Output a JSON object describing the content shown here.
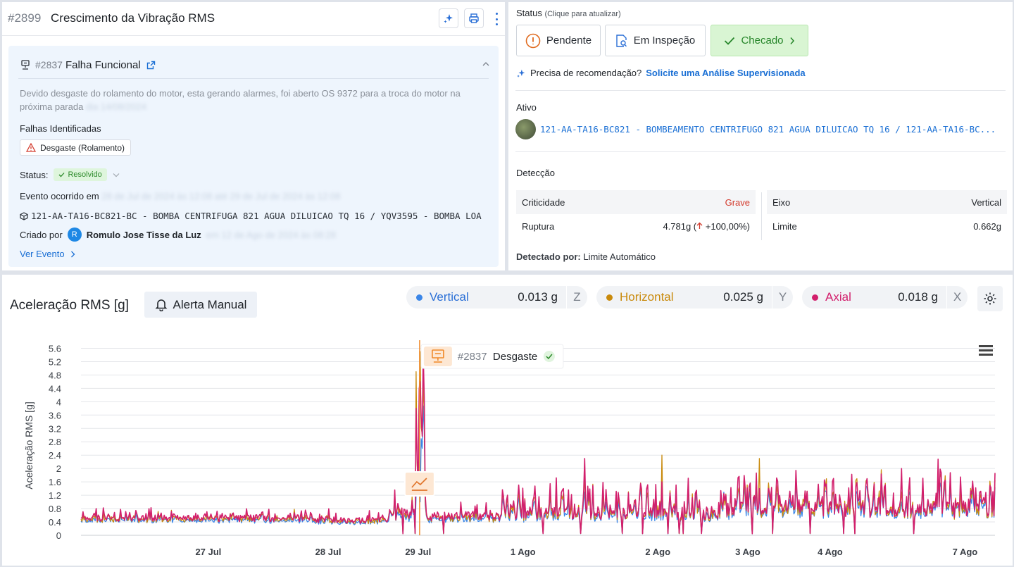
{
  "header": {
    "id": "#2899",
    "title": "Crescimento da Vibração RMS"
  },
  "event": {
    "id": "#2837",
    "title": "Falha Funcional",
    "description": "Devido desgaste do rolamento do motor, esta gerando alarmes, foi aberto OS 9372 para a troca do motor na próxima parada",
    "description_blurred": "dia 14/08/2024",
    "faults_label": "Falhas Identificadas",
    "fault_chip": "Desgaste (Rolamento)",
    "status_label": "Status:",
    "status_value": "Resolvido",
    "occurred_label": "Evento ocorrido em",
    "occurred_blurred": "28 de Jul de 2024 às 12:08 até 29 de Jul de 2024 às 12:08",
    "asset": "121-AA-TA16-BC821-BC - BOMBA CENTRIFUGA 821 AGUA DILUICAO TQ 16 / YQV3595 - BOMBA LOA",
    "created_label": "Criado por",
    "creator_initial": "R",
    "creator": "Romulo Jose Tisse da Luz",
    "created_blurred": "em 12 de Ago de 2024 às 08:28",
    "view_link": "Ver Evento"
  },
  "status_panel": {
    "title": "Status",
    "hint": "(Clique para atualizar)",
    "buttons": [
      "Pendente",
      "Em Inspeção",
      "Checado"
    ],
    "reco_text": "Precisa de recomendação?",
    "reco_link": "Solicite uma Análise Supervisionada",
    "asset_heading": "Ativo",
    "asset_link": "121-AA-TA16-BC821 - BOMBEAMENTO CENTRIFUGO 821 AGUA DILUICAO TQ 16 / 121-AA-TA16-BC...",
    "detection_heading": "Detecção",
    "det": {
      "criticidade_label": "Criticidade",
      "criticidade_value": "Grave",
      "ruptura_label": "Ruptura",
      "ruptura_value": "4.781g (",
      "ruptura_pct": " +100,00%)",
      "eixo_label": "Eixo",
      "eixo_value": "Vertical",
      "limite_label": "Limite",
      "limite_value": "0.662g"
    },
    "detected_by_label": "Detectado por:",
    "detected_by_value": "Limite Automático"
  },
  "chart_panel": {
    "title": "Aceleração RMS [g]",
    "alert_button": "Alerta Manual",
    "legend": [
      {
        "name": "Vertical",
        "value": "0.013 g",
        "axis": "Z",
        "color": "#3a86e8"
      },
      {
        "name": "Horizontal",
        "value": "0.025 g",
        "axis": "Y",
        "color": "#c98a0c"
      },
      {
        "name": "Axial",
        "value": "0.018 g",
        "axis": "X",
        "color": "#d21f6c"
      }
    ],
    "event_marker": {
      "id": "#2837",
      "label": "Desgaste"
    }
  },
  "chart_data": {
    "type": "line",
    "ylabel": "Aceleração RMS [g]",
    "ylim": [
      0,
      5.8
    ],
    "yticks": [
      "0",
      "0.4",
      "0.8",
      "1.2",
      "1.6",
      "2",
      "2.4",
      "2.8",
      "3.2",
      "3.6",
      "4",
      "4.4",
      "4.8",
      "5.2",
      "5.6"
    ],
    "xlim_days": [
      0,
      12.2
    ],
    "xticks": [
      {
        "label": "27 Jul",
        "day": 1.7
      },
      {
        "label": "28 Jul",
        "day": 3.3
      },
      {
        "label": "29 Jul",
        "day": 4.5
      },
      {
        "label": "1 Ago",
        "day": 5.9
      },
      {
        "label": "2 Ago",
        "day": 7.7
      },
      {
        "label": "3 Ago",
        "day": 8.9
      },
      {
        "label": "4 Ago",
        "day": 10.0
      },
      {
        "label": "7 Ago",
        "day": 11.8
      }
    ],
    "event_day": 4.52,
    "series": [
      {
        "name": "Vertical",
        "color": "#3a86e8"
      },
      {
        "name": "Horizontal",
        "color": "#c98a0c"
      },
      {
        "name": "Axial",
        "color": "#d21f6c"
      }
    ],
    "segments": [
      {
        "from": 0.0,
        "to": 3.0,
        "base": 0.48,
        "amp": 0.12,
        "spikes": 0.18
      },
      {
        "from": 3.0,
        "to": 4.1,
        "base": 0.42,
        "amp": 0.1,
        "spikes": 0.15
      },
      {
        "from": 4.1,
        "to": 4.45,
        "base": 0.6,
        "amp": 0.25,
        "spikes": 0.3
      },
      {
        "from": 4.45,
        "to": 4.6,
        "base": 1.6,
        "amp": 1.4,
        "spikes": 0.6
      },
      {
        "from": 4.6,
        "to": 5.6,
        "base": 0.52,
        "amp": 0.18,
        "spikes": 0.22
      },
      {
        "from": 5.6,
        "to": 8.5,
        "base": 0.62,
        "amp": 0.35,
        "spikes": 0.3
      },
      {
        "from": 8.5,
        "to": 12.2,
        "base": 0.75,
        "amp": 0.45,
        "spikes": 0.35
      }
    ],
    "peaks": [
      {
        "day": 4.48,
        "vertical": 1.2,
        "horizontal": 4.9,
        "axial": 3.8
      },
      {
        "day": 4.53,
        "vertical": 1.0,
        "horizontal": 5.5,
        "axial": 4.6
      },
      {
        "day": 6.72,
        "vertical": 1.3,
        "horizontal": 1.8,
        "axial": 2.3
      },
      {
        "day": 7.75,
        "vertical": 1.4,
        "horizontal": 2.4,
        "axial": 1.6
      },
      {
        "day": 9.05,
        "vertical": 1.2,
        "horizontal": 2.3,
        "axial": 1.4
      },
      {
        "day": 10.95,
        "vertical": 1.0,
        "horizontal": 1.3,
        "axial": 2.0
      }
    ]
  }
}
